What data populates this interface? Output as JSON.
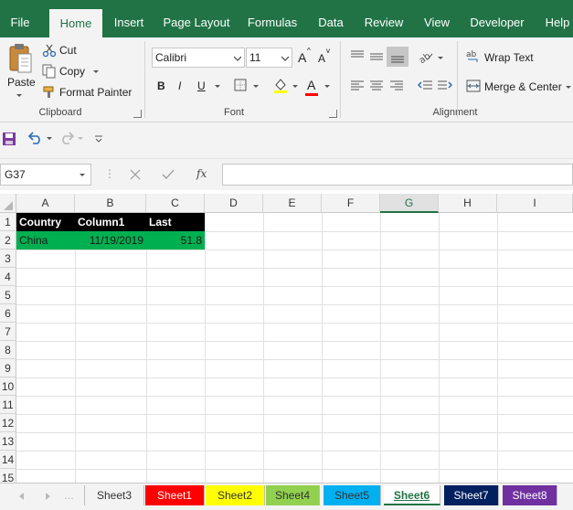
{
  "ribbon_tabs": [
    "File",
    "Home",
    "Insert",
    "Page Layout",
    "Formulas",
    "Data",
    "Review",
    "View",
    "Developer",
    "Help"
  ],
  "active_tab": "Home",
  "clipboard": {
    "paste_label": "Paste",
    "cut_label": "Cut",
    "copy_label": "Copy",
    "format_painter_label": "Format Painter",
    "group_label": "Clipboard"
  },
  "font": {
    "font_name": "Calibri",
    "font_size": "11",
    "bold_label": "B",
    "italic_label": "I",
    "underline_label": "U",
    "font_color_label": "A",
    "grow_font_label": "A",
    "shrink_font_label": "A",
    "group_label": "Font"
  },
  "alignment": {
    "wrap_text_label": "Wrap Text",
    "merge_center_label": "Merge & Center",
    "group_label": "Alignment"
  },
  "formula_bar": {
    "name_box": "G37",
    "fx_label": "fx",
    "formula_value": ""
  },
  "columns": [
    "A",
    "B",
    "C",
    "D",
    "E",
    "F",
    "G",
    "H",
    "I"
  ],
  "selected_column": "G",
  "rows": [
    "1",
    "2",
    "3",
    "4",
    "5",
    "6",
    "7",
    "8",
    "9",
    "10",
    "11",
    "12",
    "13",
    "14",
    "15"
  ],
  "cells": {
    "a1": "Country",
    "b1": "Column1",
    "c1": "Last",
    "a2": "China",
    "b2": "11/19/2019",
    "c2": "51.8"
  },
  "sheet_tabs": [
    {
      "name": "Sheet3",
      "color": "#f3f3f3",
      "text": "#333333"
    },
    {
      "name": "Sheet1",
      "color": "#ff0000",
      "text": "#ffffff"
    },
    {
      "name": "Sheet2",
      "color": "#ffff00",
      "text": "#333333"
    },
    {
      "name": "Sheet4",
      "color": "#92d050",
      "text": "#333333"
    },
    {
      "name": "Sheet5",
      "color": "#00b0f0",
      "text": "#333333"
    },
    {
      "name": "Sheet6",
      "color": "#ffffff",
      "text": "#217346"
    },
    {
      "name": "Sheet7",
      "color": "#002060",
      "text": "#ffffff"
    },
    {
      "name": "Sheet8",
      "color": "#7030a0",
      "text": "#ffffff"
    }
  ],
  "active_sheet": "Sheet6",
  "colors": {
    "accent": "#217346",
    "header_fill": "#000000",
    "data_fill": "#00b050"
  }
}
